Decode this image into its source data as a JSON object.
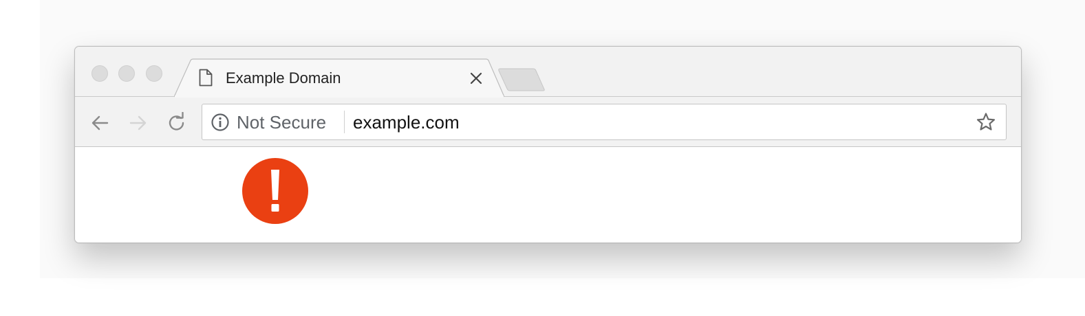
{
  "window": {
    "traffic_lights": [
      "close",
      "minimize",
      "zoom"
    ]
  },
  "tab": {
    "title": "Example Domain",
    "icon": "document-icon",
    "close_icon": "close-icon"
  },
  "new_tab": {
    "icon": "new-tab-icon"
  },
  "toolbar": {
    "back_icon": "back-arrow-icon",
    "forward_icon": "forward-arrow-icon",
    "reload_icon": "reload-icon",
    "forward_enabled": false
  },
  "omnibox": {
    "security_icon": "info-icon",
    "security_label": "Not Secure",
    "url": "example.com",
    "bookmark_icon": "star-icon"
  },
  "content": {
    "badge_icon": "exclamation-icon",
    "badge_color": "#ea4012"
  }
}
